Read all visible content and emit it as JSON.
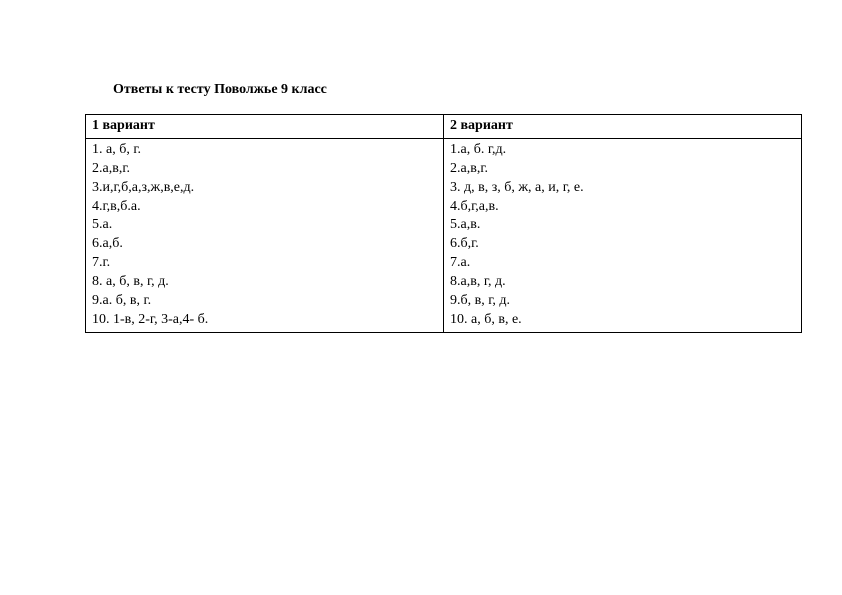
{
  "title": "Ответы к тесту Поволжье 9 класс",
  "table": {
    "columns": [
      {
        "header": "1 вариант",
        "answers": [
          "1. а, б, г.",
          "2.а,в,г.",
          "3.и,г,б,а,з,ж,в,е,д.",
          "4.г,в,б.а.",
          "5.а.",
          "6.а,б.",
          "7.г.",
          "8. а, б, в, г, д.",
          "9.а. б, в, г.",
          "10. 1-в, 2-г, 3-а,4- б."
        ]
      },
      {
        "header": "2 вариант",
        "answers": [
          "1.а, б. г,д.",
          "2.а,в,г.",
          "3. д, в, з, б, ж, а, и, г, е.",
          "4.б,г,а,в.",
          "5.а,в.",
          "6.б,г.",
          "7.а.",
          "8.а,в, г, д.",
          "9.б, в, г, д.",
          "10. а, б, в, е."
        ]
      }
    ]
  }
}
